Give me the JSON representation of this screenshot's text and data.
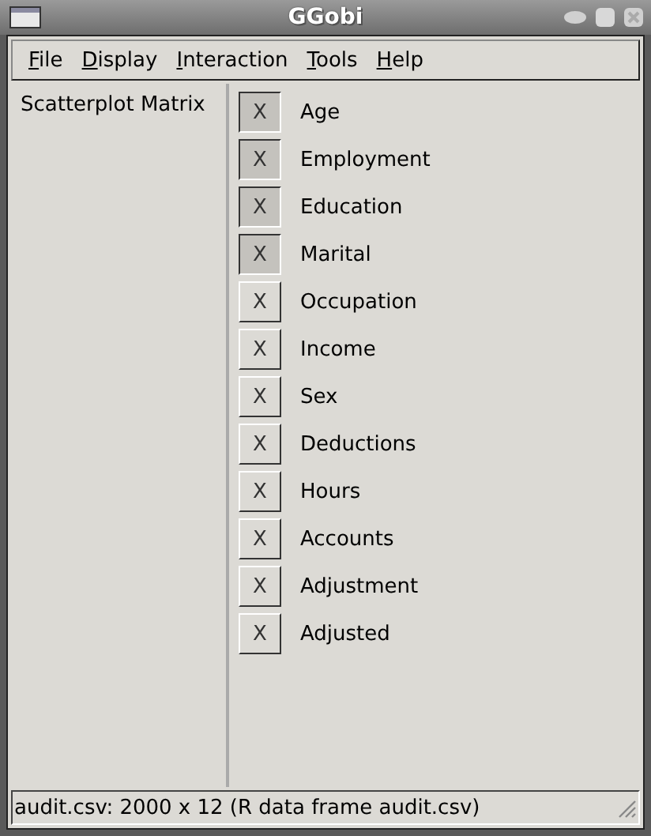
{
  "window": {
    "title": "GGobi"
  },
  "menu": [
    {
      "label": "File"
    },
    {
      "label": "Display"
    },
    {
      "label": "Interaction"
    },
    {
      "label": "Tools"
    },
    {
      "label": "Help"
    }
  ],
  "sidebar": {
    "items": [
      {
        "label": "Scatterplot Matrix"
      }
    ]
  },
  "variables": [
    {
      "toggle": "X",
      "label": "Age",
      "selected": true
    },
    {
      "toggle": "X",
      "label": "Employment",
      "selected": true
    },
    {
      "toggle": "X",
      "label": "Education",
      "selected": true
    },
    {
      "toggle": "X",
      "label": "Marital",
      "selected": true
    },
    {
      "toggle": "X",
      "label": "Occupation",
      "selected": false
    },
    {
      "toggle": "X",
      "label": "Income",
      "selected": false
    },
    {
      "toggle": "X",
      "label": "Sex",
      "selected": false
    },
    {
      "toggle": "X",
      "label": "Deductions",
      "selected": false
    },
    {
      "toggle": "X",
      "label": "Hours",
      "selected": false
    },
    {
      "toggle": "X",
      "label": "Accounts",
      "selected": false
    },
    {
      "toggle": "X",
      "label": "Adjustment",
      "selected": false
    },
    {
      "toggle": "X",
      "label": "Adjusted",
      "selected": false
    }
  ],
  "status_bar": "audit.csv: 2000 x 12 (R data frame audit.csv)"
}
